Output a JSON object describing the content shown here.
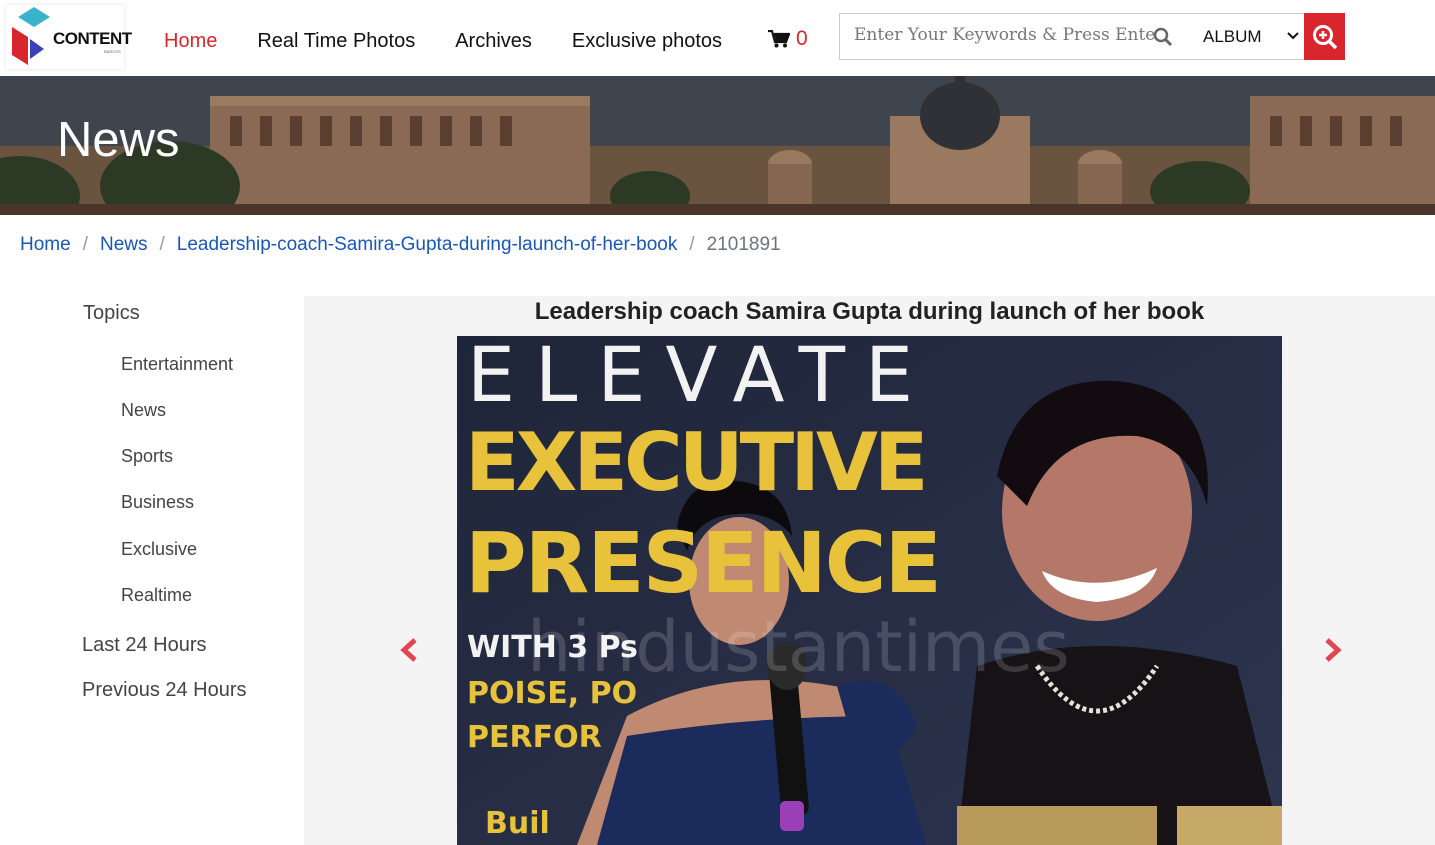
{
  "brand": {
    "logo_text": "CONTENT",
    "logo_sub": "BAROSS"
  },
  "nav": {
    "items": [
      "Home",
      "Real Time Photos",
      "Archives",
      "Exclusive photos"
    ],
    "cart_count": "0"
  },
  "search": {
    "placeholder": "Enter Your Keywords & Press Enter",
    "scope": "ALBUM"
  },
  "banner": {
    "title": "News"
  },
  "breadcrumb": {
    "items": [
      "Home",
      "News",
      "Leadership-coach-Samira-Gupta-during-launch-of-her-book"
    ],
    "current": "2101891"
  },
  "sidebar": {
    "heading": "Topics",
    "topics": [
      "Entertainment",
      "News",
      "Sports",
      "Business",
      "Exclusive",
      "Realtime"
    ],
    "links": [
      "Last 24 Hours",
      "Previous 24 Hours"
    ]
  },
  "main": {
    "title": "Leadership coach Samira Gupta during launch of her book",
    "photo_text": {
      "line1": "ELEVATE",
      "line2": "EXECUTIVE",
      "line3": "PRESENCE",
      "line4": "WITH 3 Ps",
      "line5": "POISE, PO",
      "line6": "PERFOR",
      "line7": "Buil",
      "watermark": "hindustantimes"
    }
  },
  "colors": {
    "accent": "#d9252d",
    "link": "#1a55b8",
    "arrow": "#e0474f"
  }
}
